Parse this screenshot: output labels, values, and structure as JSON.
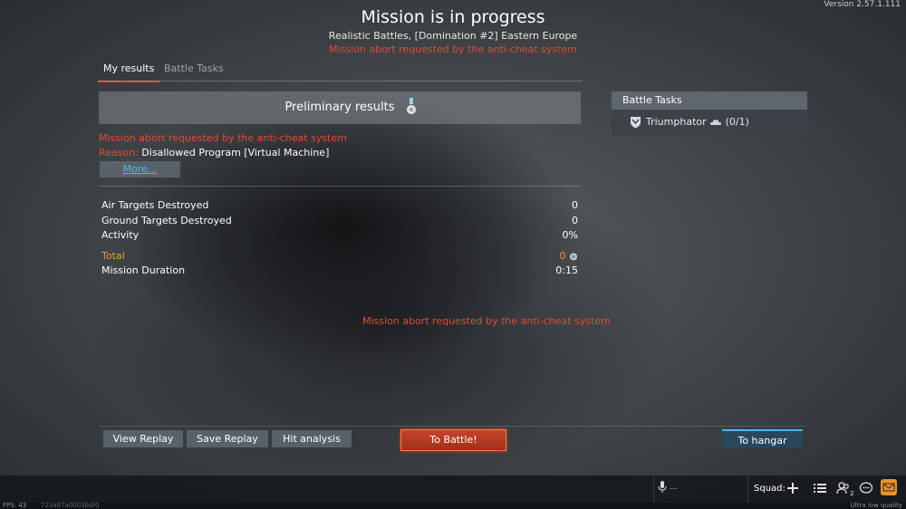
{
  "version": "Version 2.57.1.111",
  "header": {
    "title": "Mission is in progress",
    "subtitle": "Realistic Battles, [Domination #2] Eastern Europe",
    "abort_message": "Mission abort requested by the anti-cheat system"
  },
  "tabs": [
    {
      "label": "My results",
      "active": true
    },
    {
      "label": "Battle Tasks",
      "active": false
    }
  ],
  "results": {
    "preliminary_label": "Preliminary results",
    "abort_message": "Mission abort requested by the anti-cheat system",
    "reason_label": "Reason:",
    "reason_value": "Disallowed Program [Virtual Machine]",
    "more_label": "More...",
    "stats": [
      {
        "label": "Air Targets Destroyed",
        "value": "0"
      },
      {
        "label": "Ground Targets Destroyed",
        "value": "0"
      },
      {
        "label": "Activity",
        "value": "0%"
      }
    ],
    "total_label": "Total",
    "total_value": "0",
    "duration_label": "Mission Duration",
    "duration_value": "0:15",
    "bottom_abort_message": "Mission abort requested by the anti-cheat system"
  },
  "battle_tasks": {
    "header": "Battle Tasks",
    "items": [
      {
        "label": "Triumphator",
        "progress": "(0/1)",
        "icon": "shield-icon"
      }
    ]
  },
  "buttons": {
    "view_replay": "View Replay",
    "save_replay": "Save Replay",
    "hit_analysis": "Hit analysis",
    "to_battle": "To Battle!",
    "to_hangar": "To hangar"
  },
  "footer": {
    "mic_text": "...",
    "squad_label": "Squad:",
    "friends_count": "2",
    "fps": "FPS: 43",
    "session_hash": "723a87a00036df0",
    "quality": "Ultra low quality"
  },
  "colors": {
    "alert_red": "#e44a35",
    "accent_orange": "#e79c3d",
    "link_blue": "#4fb4ea",
    "battle_button": "#b3391f",
    "mail_orange": "#e69332"
  }
}
